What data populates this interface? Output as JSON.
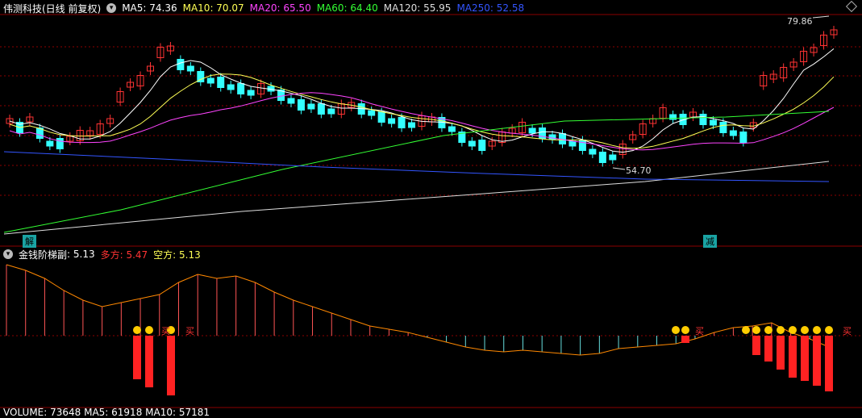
{
  "main_header": {
    "title": "伟测科技(日线 前复权)",
    "indicators": [
      {
        "label": "MA5: 74.36",
        "color": "#ffffff"
      },
      {
        "label": "MA10: 70.07",
        "color": "#ffff55"
      },
      {
        "label": "MA20: 65.50",
        "color": "#ff44ff"
      },
      {
        "label": "MA60: 64.40",
        "color": "#33ff33"
      },
      {
        "label": "MA120: 55.95",
        "color": "#dddddd"
      },
      {
        "label": "MA250: 52.58",
        "color": "#3355ff"
      }
    ]
  },
  "price_annotations": {
    "high": "79.86",
    "low": "54.70"
  },
  "markers": {
    "left": "解",
    "right": "减"
  },
  "sub_header": {
    "title": "金钱阶梯副",
    "value": ": 5.13",
    "bull": "多方: 5.47",
    "bear": "空方: 5.13"
  },
  "signal_text": "买",
  "bottom_header": {
    "text": "VOLUME: 73648  MA5: 61918  MA10: 57181"
  },
  "colors": {
    "bg": "#000000",
    "grid": "#8b0000",
    "up": "#ff3333",
    "down": "#33ffff",
    "ma5": "#ffffff",
    "ma10": "#ffff55",
    "ma20": "#ff44ff",
    "ma60": "#33ff33",
    "ma120": "#dddddd",
    "ma250": "#3355ff",
    "step_line": "#ff8800",
    "step_up": "#ff2222"
  },
  "icons": {
    "collapse": "chevron-down-icon",
    "diamond": "diamond-icon"
  }
}
